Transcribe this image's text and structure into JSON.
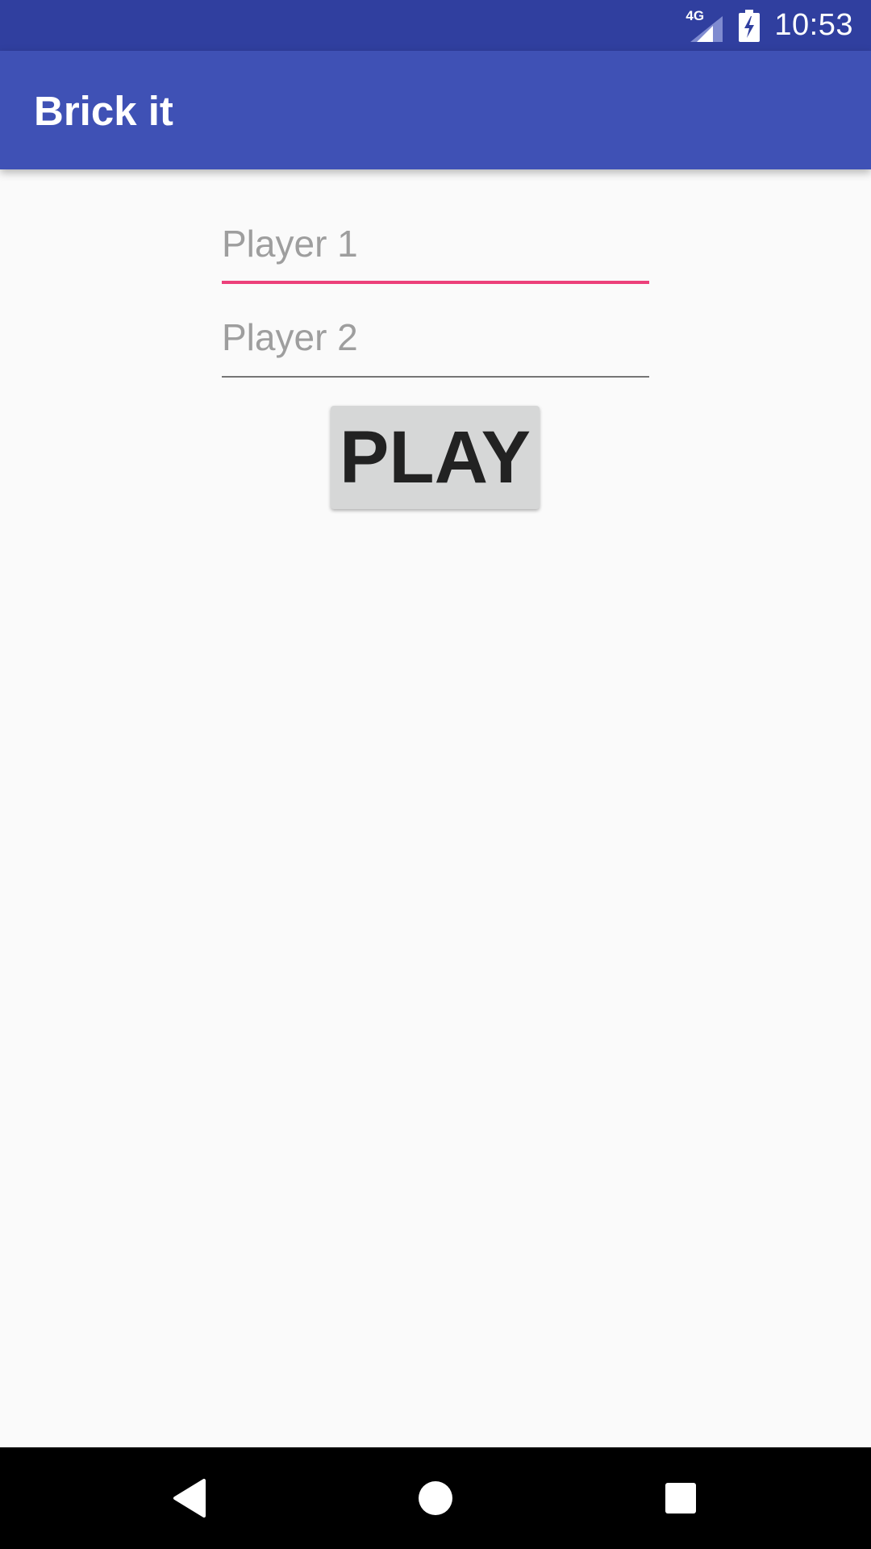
{
  "status_bar": {
    "network_label": "4G",
    "time": "10:53"
  },
  "app_bar": {
    "title": "Brick it"
  },
  "form": {
    "player1": {
      "placeholder": "Player 1",
      "value": ""
    },
    "player2": {
      "placeholder": "Player 2",
      "value": ""
    },
    "play_label": "PLAY"
  },
  "nav_bar": {
    "icons": [
      "back-icon",
      "home-icon",
      "recents-icon"
    ]
  },
  "colors": {
    "status_bar": "#303f9f",
    "app_bar": "#3f51b5",
    "focus_accent": "#ec407a",
    "background": "#fafafa",
    "button": "#d6d7d7"
  }
}
